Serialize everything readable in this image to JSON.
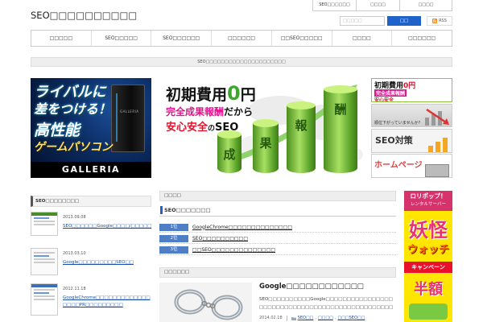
{
  "header": {
    "logo": "SEO□□□□□□□□□□",
    "top_links": [
      "SEO□□□□□□",
      "□□□□",
      "□□□□"
    ],
    "search": {
      "placeholder": "□□□□□",
      "button_label": "□□"
    },
    "rss_label": "RSS"
  },
  "nav": {
    "items": [
      "□□□□□",
      "SEO□□□□□",
      "SEO□□□□□□",
      "□□□□□□",
      "□□SEO□□□□□",
      "□□□□",
      "□□□□□□"
    ]
  },
  "notice": "SEO□□□□□□□□□□□□□□□□□□□□□",
  "banners": {
    "galleria": {
      "lines": [
        "ライバルに",
        "差をつける！",
        "高性能",
        "ゲームパソコン"
      ],
      "case_brand": "GALLERIA",
      "brand": "GALLERIA"
    },
    "main": {
      "title": "初期費用",
      "zero": "0",
      "yen": "円",
      "line2_highlight": "完全成果報酬",
      "line2_rest": "だから",
      "line3_highlight": "安心安全",
      "line3_no": "の",
      "line3_seo": "SEO",
      "bars": [
        "成",
        "果",
        "報",
        "酬"
      ]
    },
    "side": {
      "first": {
        "title": "初期費用",
        "price": "0円",
        "line2": "完全成果報酬",
        "line3": "安心安全"
      },
      "second": "順位下がっていませんか？",
      "third": "SEO対策",
      "fourth": "ホームページ"
    }
  },
  "sidebar": {
    "heading": "SEO□□□□□□□□",
    "posts": [
      {
        "date": "2013.09.08",
        "title": "SEO□□□□□□Google□□□□/□□□□□"
      },
      {
        "date": "2013.03.10",
        "title": "Google□□□□□□□□□SEO□□"
      },
      {
        "date": "2012.11.18",
        "title": "GoogleChrome□□□□□□□□□□□□□□□□□PR□□□□□□□□□"
      }
    ]
  },
  "main": {
    "section_title_1": "□□□□",
    "ranking_heading": "SEO□□□□□□□",
    "ranking": [
      {
        "rank": "1位",
        "title": "GoogleChrome□□□□□□□□□□□□□□"
      },
      {
        "rank": "2位",
        "title": "SEO□□□□□□□□□□"
      },
      {
        "rank": "3位",
        "title": "□□SEO□□□□□□□□□□□□□□"
      }
    ],
    "section_title_2": "□□□□□□",
    "article": {
      "title": "Google□□□□□□□□□□□□",
      "excerpt": "SEO□□□□□□□□□□Google□□□□□□□□□□□□□□□□□□□□□□□□□□□□□□□□□□□□□□□□□□□□□□□□□□□□□□□□□□□□□□□□□□□□□",
      "date": "2014.02.18",
      "categories": [
        "SEO□□",
        "□□□□",
        "□□□SEO□□"
      ],
      "cat_separator": ","
    }
  },
  "ad": {
    "brand": "ロリポップ！",
    "sub": "レンタルサーバー",
    "big1": "妖怪",
    "big2": "ウォッチ",
    "band": "キャンペーン",
    "big3": "半額"
  },
  "colors": {
    "accent_blue": "#1f62c9",
    "rank_badge": "#4d7ec6",
    "link": "#1a4fa3",
    "banner_green": "#3aa82a",
    "banner_magenta": "#e0148c"
  },
  "icons": [
    "rss-icon",
    "folder-icon"
  ]
}
